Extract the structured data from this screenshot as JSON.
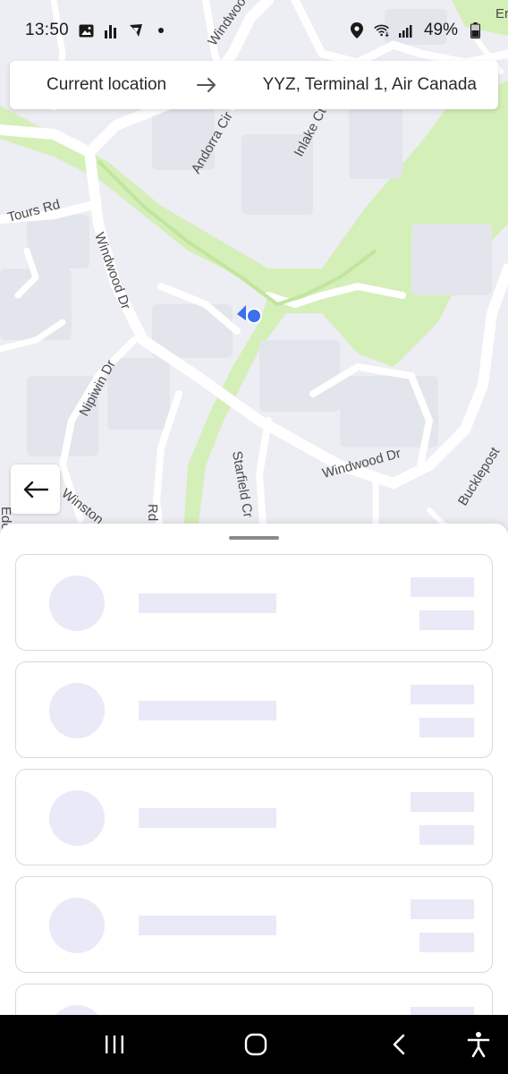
{
  "status_bar": {
    "time": "13:50",
    "battery": "49%",
    "left_icons": [
      "gallery-icon",
      "signal-bars-icon",
      "cast-icon",
      "dot-icon"
    ],
    "right_icons": [
      "location-pin-icon",
      "wifi-icon",
      "cellular-icon",
      "battery-icon"
    ]
  },
  "route": {
    "origin": "Current location",
    "destination": "YYZ, Terminal 1, Air Canada",
    "arrow_icon": "arrow-right-icon"
  },
  "map": {
    "streets": [
      "Windwood Dr",
      "Andorra Cir",
      "Inlake Ct",
      "Tours Rd",
      "Windwood Dr",
      "Nipiwin Dr",
      "Windwood Dr",
      "Starfield Cr",
      "Winston",
      "Rd",
      "Bucklepost",
      "Edo",
      "Er"
    ],
    "colors": {
      "background": "#eceef3",
      "park": "#d5efb8",
      "road": "#ffffff",
      "location_dot": "#3d6fee"
    }
  },
  "back_button": {
    "icon": "arrow-left-icon"
  },
  "sheet": {
    "skeleton_cards": 5,
    "skeleton_color": "#eae9f7"
  },
  "nav_bar": {
    "icons": [
      "recent-apps-icon",
      "home-icon",
      "back-icon",
      "accessibility-icon"
    ]
  }
}
